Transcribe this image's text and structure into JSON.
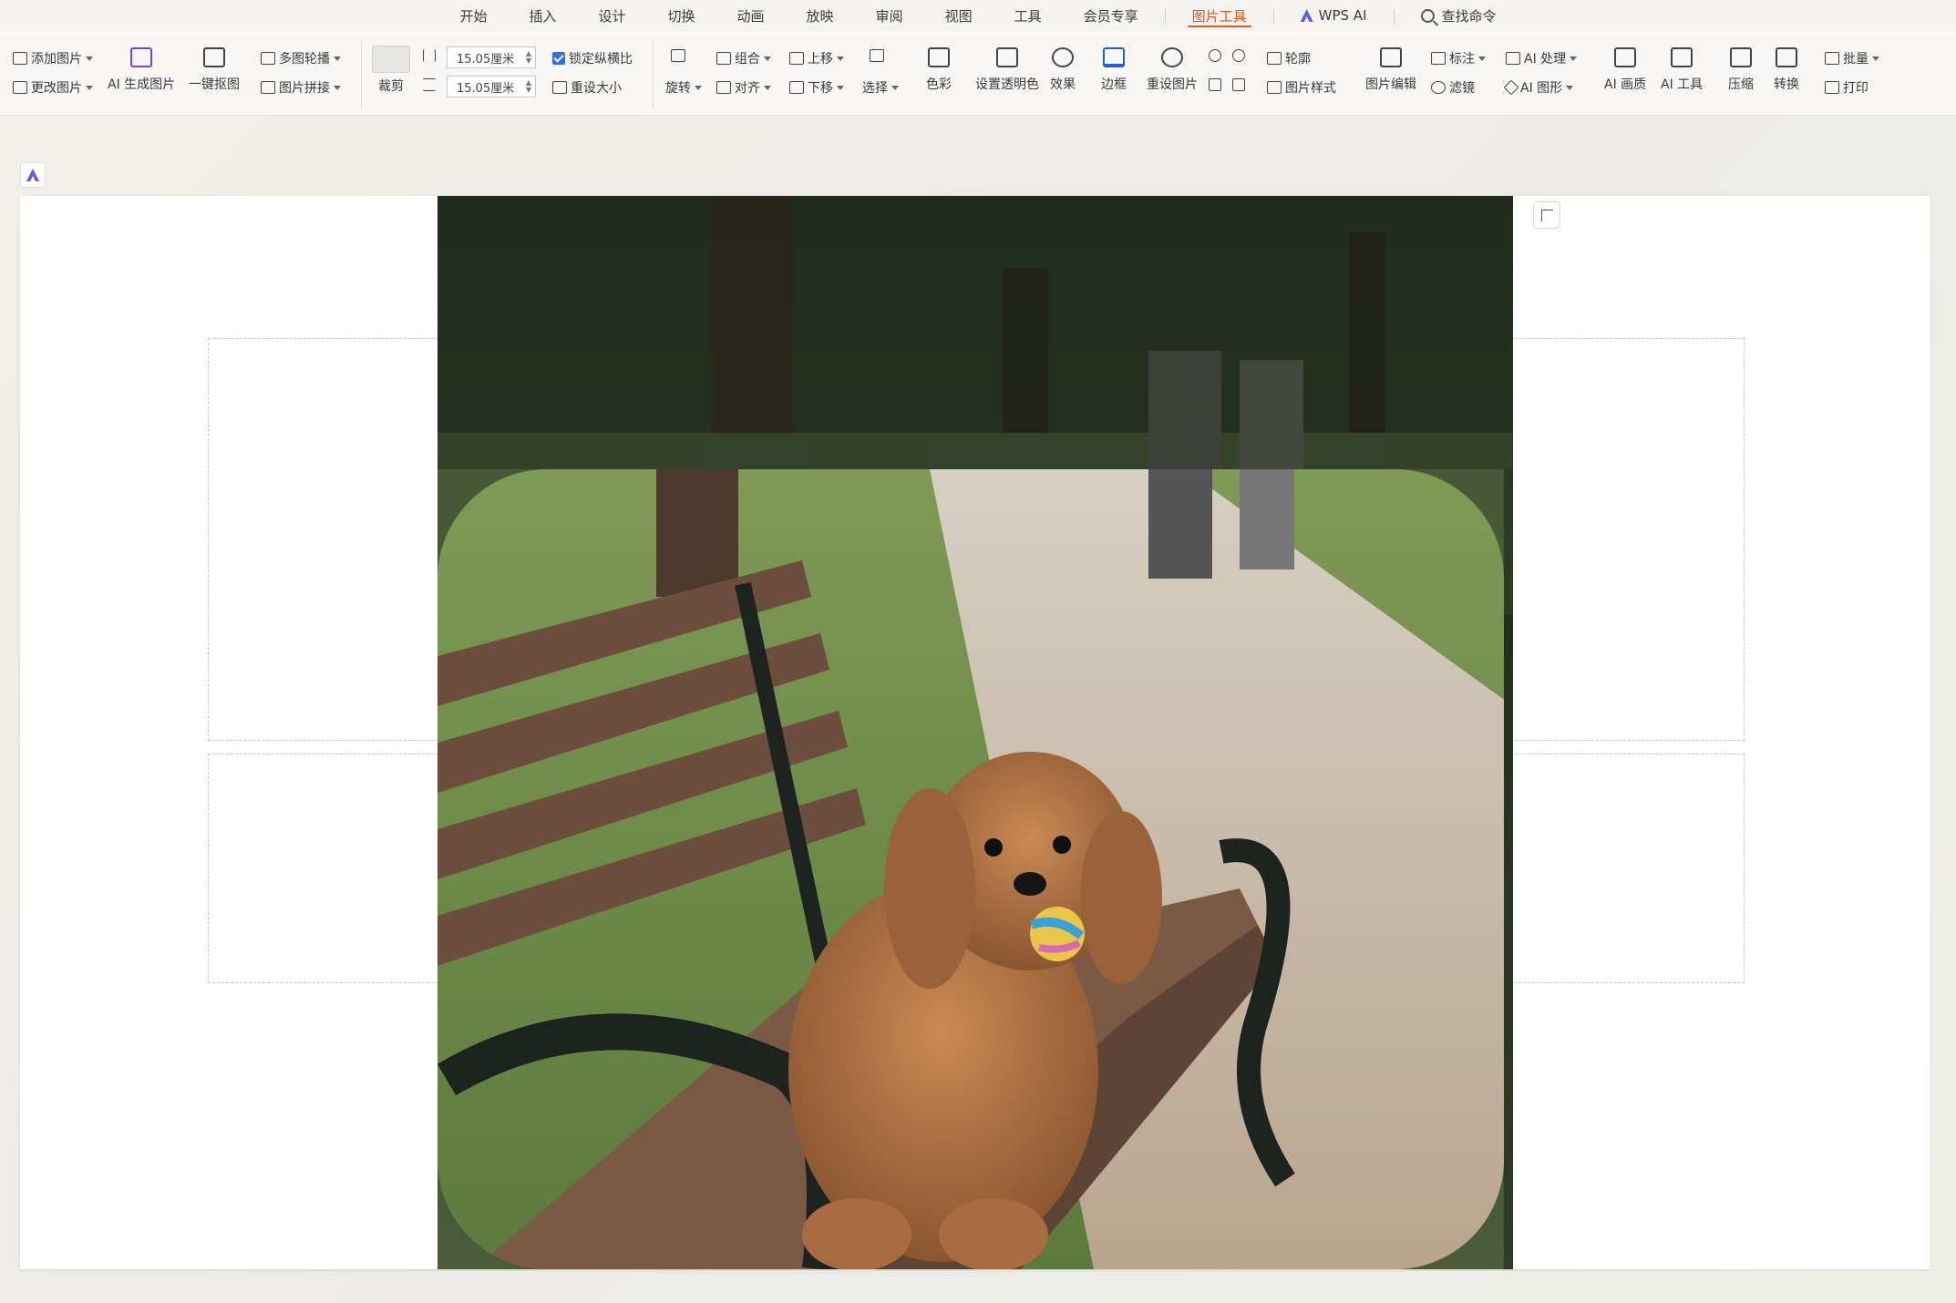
{
  "tabs": [
    {
      "id": "start",
      "label": "开始"
    },
    {
      "id": "insert",
      "label": "插入"
    },
    {
      "id": "design",
      "label": "设计"
    },
    {
      "id": "transition",
      "label": "切换"
    },
    {
      "id": "animation",
      "label": "动画"
    },
    {
      "id": "slideshow",
      "label": "放映"
    },
    {
      "id": "review",
      "label": "审阅"
    },
    {
      "id": "view",
      "label": "视图"
    },
    {
      "id": "tools",
      "label": "工具"
    },
    {
      "id": "member",
      "label": "会员专享"
    },
    {
      "id": "picture_tools",
      "label": "图片工具"
    }
  ],
  "active_tab": "图片工具",
  "wps_ai_label": "WPS AI",
  "search_label": "查找命令",
  "ribbon": {
    "add_picture": "添加图片",
    "replace_picture": "更改图片",
    "ai_gen_picture": "AI 生成图片",
    "one_click": "一键抠图",
    "multi_crop": "多图轮播",
    "picture_split": "图片拼接",
    "crop": "裁剪",
    "width_value": "15.05厘米",
    "height_value": "15.05厘米",
    "lock_ratio": "锁定纵横比",
    "reset_size": "重设大小",
    "rotate": "旋转",
    "combine": "组合",
    "align": "对齐",
    "move_up": "上移",
    "move_down": "下移",
    "select": "选择",
    "color": "色彩",
    "set_transparent": "设置透明色",
    "effects": "效果",
    "border": "边框",
    "reset_picture": "重设图片",
    "outline": "轮廓",
    "picture_style": "图片样式",
    "picture_edit": "图片编辑",
    "mark": "标注",
    "ai_blend": "AI 处理",
    "ai_shape": "AI 图形",
    "filter": "滤镜",
    "ai_enhance": "AI 画质",
    "ai_tools": "AI 工具",
    "compress": "压缩",
    "convert": "转换",
    "batch": "批量",
    "print": "打印"
  },
  "colors": {
    "accent": "#e05a1f",
    "checkbox": "#2f6fe8",
    "ribbon_bg": "#f8f7f5"
  }
}
